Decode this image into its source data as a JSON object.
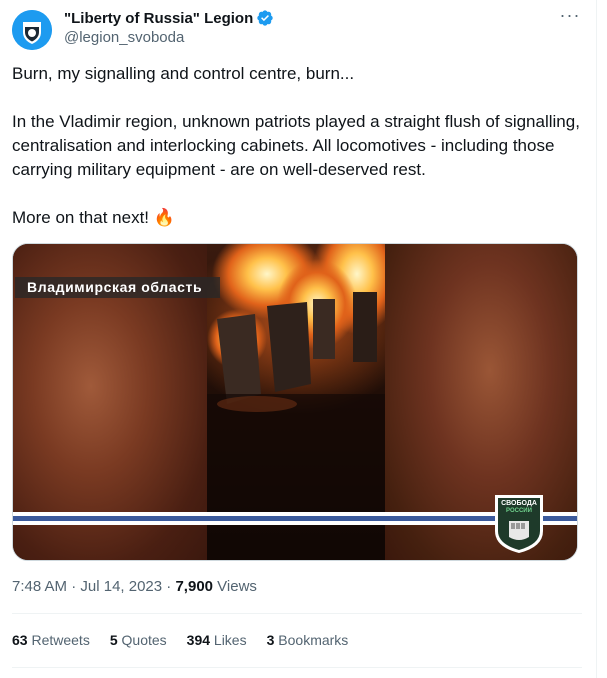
{
  "author": {
    "display_name": "\"Liberty of Russia\" Legion",
    "handle": "@legion_svoboda",
    "verified": true,
    "avatar_icon": "legion-shield-icon"
  },
  "more_icon": "more-horizontal-icon",
  "more_label": "···",
  "tweet": {
    "line1": "Burn, my signalling and control centre, burn...",
    "line2": "In the Vladimir region, unknown patriots played a straight flush of signalling, centralisation and interlocking cabinets. All locomotives - including those carrying military equipment - are on well-deserved rest.",
    "line3": "More on that next! 🔥"
  },
  "media": {
    "caption_overlay": "Владимирская область",
    "logo_text_top": "СВОБОДА",
    "logo_text_bottom": "РОССИИ",
    "stripe_colors": [
      "#ffffff",
      "#3b5a9c",
      "#ffffff"
    ]
  },
  "meta": {
    "time": "7:48 AM",
    "separator": " · ",
    "date": "Jul 14, 2023",
    "views_count": "7,900",
    "views_label": " Views"
  },
  "stats": {
    "retweets_count": "63",
    "retweets_label": " Retweets",
    "quotes_count": "5",
    "quotes_label": " Quotes",
    "likes_count": "394",
    "likes_label": " Likes",
    "bookmarks_count": "3",
    "bookmarks_label": " Bookmarks"
  },
  "colors": {
    "accent": "#1d9bf0",
    "text_primary": "#0f1419",
    "text_secondary": "#536471"
  }
}
